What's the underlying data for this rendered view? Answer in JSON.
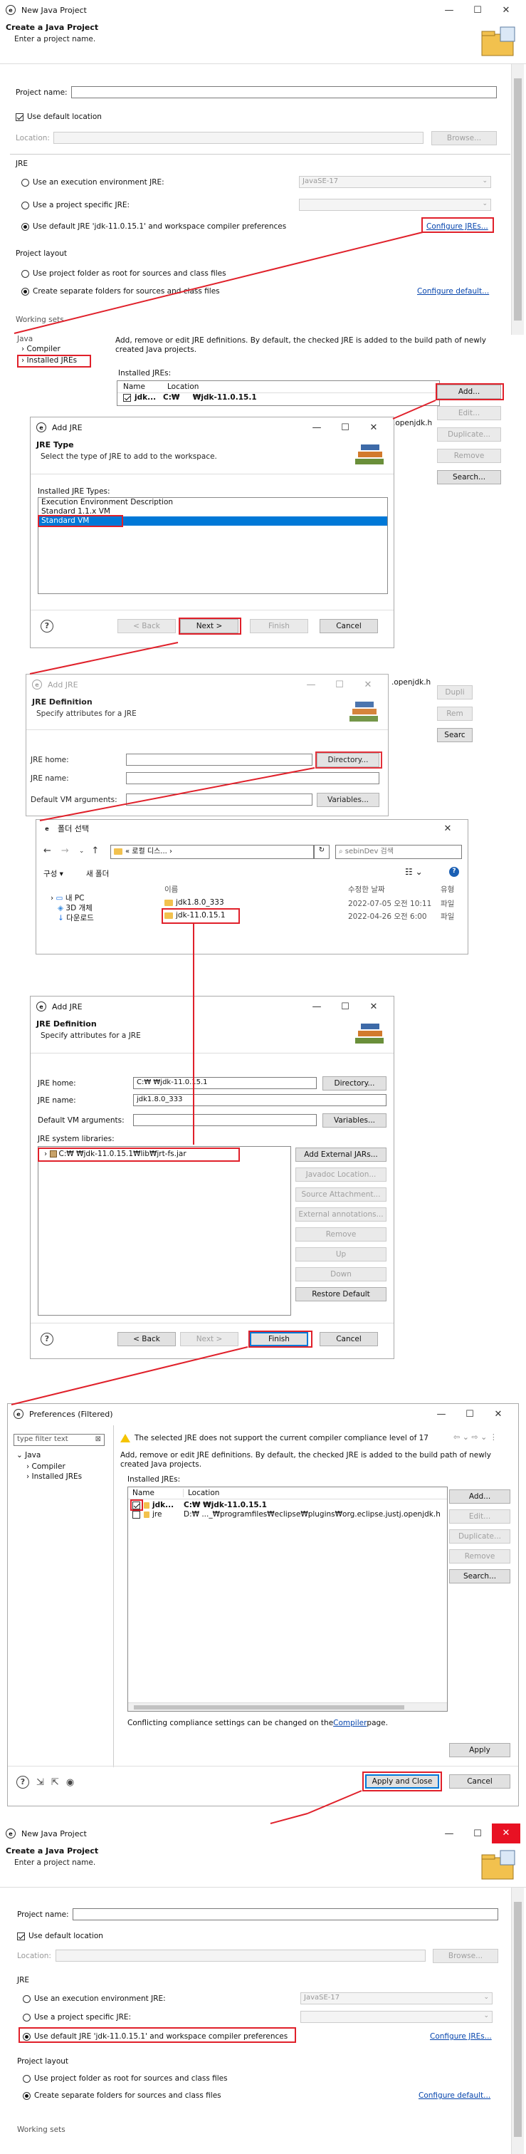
{
  "w1": {
    "title": "New Java Project",
    "h1": "Create a Java Project",
    "h2": "Enter a project name.",
    "project_name_label": "Project name:",
    "project_name_value": "",
    "use_default_location": "Use default location",
    "location_label": "Location:",
    "location_value": "",
    "browse": "Browse...",
    "jre_group": "JRE",
    "jre_opt1": "Use an execution environment JRE:",
    "jre_opt1_value": "JavaSE-17",
    "jre_opt2": "Use a project specific JRE:",
    "jre_opt3": "Use default JRE 'jdk-11.0.15.1' and workspace compiler preferences",
    "configure_jres": "Configure JREs...",
    "layout_group": "Project layout",
    "layout_opt1": "Use project folder as root for sources and class files",
    "layout_opt2": "Create separate folders for sources and class files",
    "configure_default": "Configure default...",
    "working_sets": "Working sets"
  },
  "p1": {
    "tree_java": "Java",
    "tree_compiler": "Compiler",
    "tree_installed": "Installed JREs",
    "desc": "Add, remove or edit JRE definitions. By default, the checked JRE is added to the build path of newly created Java projects.",
    "installed_jres": "Installed JREs:",
    "col_name": "Name",
    "col_location": "Location",
    "row1_name": "jdk...",
    "row1_loc": "C:₩",
    "row1_loc2": "₩jdk-11.0.15.1",
    "openjdk": ".openjdk.h",
    "add": "Add...",
    "edit": "Edit...",
    "duplicate": "Duplicate...",
    "remove": "Remove",
    "search": "Search..."
  },
  "d1": {
    "title": "Add JRE",
    "h1": "JRE Type",
    "h2": "Select the type of JRE to add to the workspace.",
    "types_label": "Installed JRE Types:",
    "types": [
      "Execution Environment Description",
      "Standard 1.1.x VM",
      "Standard VM"
    ],
    "back": "< Back",
    "next": "Next >",
    "finish": "Finish",
    "cancel": "Cancel"
  },
  "d2": {
    "title": "Add JRE",
    "h1": "JRE Definition",
    "h2": "Specify attributes for a JRE",
    "jre_home": "JRE home:",
    "jre_name": "JRE name:",
    "vm_args": "Default VM arguments:",
    "directory": "Directory...",
    "variables": "Variables...",
    "openjdk": ".openjdk.h",
    "dup": "Dupli",
    "rem": "Rem",
    "sear": "Searc"
  },
  "f1": {
    "title": "폴더 선택",
    "path": "« 로컬 디스... ›",
    "search_ph": "sebinDev 검색",
    "organize": "구성 ▾",
    "new_folder": "새 폴더",
    "tree": [
      "내 PC",
      "3D 개체",
      "다운로드"
    ],
    "col_name": "이름",
    "col_date": "수정한 날짜",
    "col_type": "유형",
    "files": [
      {
        "name": "jdk1.8.0_333",
        "date": "2022-07-05 오전 10:11",
        "type": "파일"
      },
      {
        "name": "jdk-11.0.15.1",
        "date": "2022-04-26 오전 6:00",
        "type": "파일"
      }
    ]
  },
  "d3": {
    "title": "Add JRE",
    "h1": "JRE Definition",
    "h2": "Specify attributes for a JRE",
    "jre_home": "JRE home:",
    "jre_home_value": "C:₩          ₩jdk-11.0.15.1",
    "jre_name": "JRE name:",
    "jre_name_value": "jdk1.8.0_333",
    "vm_args": "Default VM arguments:",
    "sys_libs": "JRE system libraries:",
    "lib": "C:₩          ₩jdk-11.0.15.1₩lib₩jrt-fs.jar",
    "directory": "Directory...",
    "variables": "Variables...",
    "add_ext": "Add External JARs...",
    "javadoc": "Javadoc Location...",
    "source": "Source Attachment...",
    "ext_ann": "External annotations...",
    "remove": "Remove",
    "up": "Up",
    "down": "Down",
    "restore": "Restore Default",
    "back": "< Back",
    "next": "Next >",
    "finish": "Finish",
    "cancel": "Cancel"
  },
  "p2": {
    "title": "Preferences (Filtered)",
    "filter": "type filter text",
    "tree_java": "Java",
    "tree_compiler": "Compiler",
    "tree_installed": "Installed JREs",
    "warning": "The selected JRE does not support the current compiler compliance level of 17",
    "desc": "Add, remove or edit JRE definitions. By default, the checked JRE is added to the build path of newly created Java projects.",
    "installed_jres": "Installed JREs:",
    "col_name": "Name",
    "col_location": "Location",
    "row1_name": "jdk...",
    "row1_loc": "C:₩           ₩jdk-11.0.15.1",
    "row2_name": "jre",
    "row2_loc": "D:₩     ..._₩programfiles₩eclipse₩plugins₩org.eclipse.justj.openjdk.h",
    "add": "Add...",
    "edit": "Edit...",
    "duplicate": "Duplicate...",
    "remove": "Remove",
    "search": "Search...",
    "conflict_pre": "Conflicting compliance settings can be changed on the ",
    "conflict_link": "Compiler",
    "conflict_post": " page.",
    "apply": "Apply",
    "apply_close": "Apply and Close",
    "cancel": "Cancel"
  },
  "w2": {
    "title": "New Java Project",
    "h1": "Create a Java Project",
    "h2": "Enter a project name.",
    "project_name_label": "Project name:",
    "use_default_location": "Use default location",
    "location_label": "Location:",
    "browse": "Browse...",
    "jre_group": "JRE",
    "jre_opt1": "Use an execution environment JRE:",
    "jre_opt1_value": "JavaSE-17",
    "jre_opt2": "Use a project specific JRE:",
    "jre_opt3": "Use default JRE 'jdk-11.0.15.1' and workspace compiler preferences",
    "configure_jres": "Configure JREs...",
    "layout_group": "Project layout",
    "layout_opt1": "Use project folder as root for sources and class files",
    "layout_opt2": "Create separate folders for sources and class files",
    "configure_default": "Configure default...",
    "working_sets": "Working sets"
  },
  "colors": {
    "red": "#e0202a",
    "accent": "#0078d7",
    "link": "#0645ad"
  }
}
